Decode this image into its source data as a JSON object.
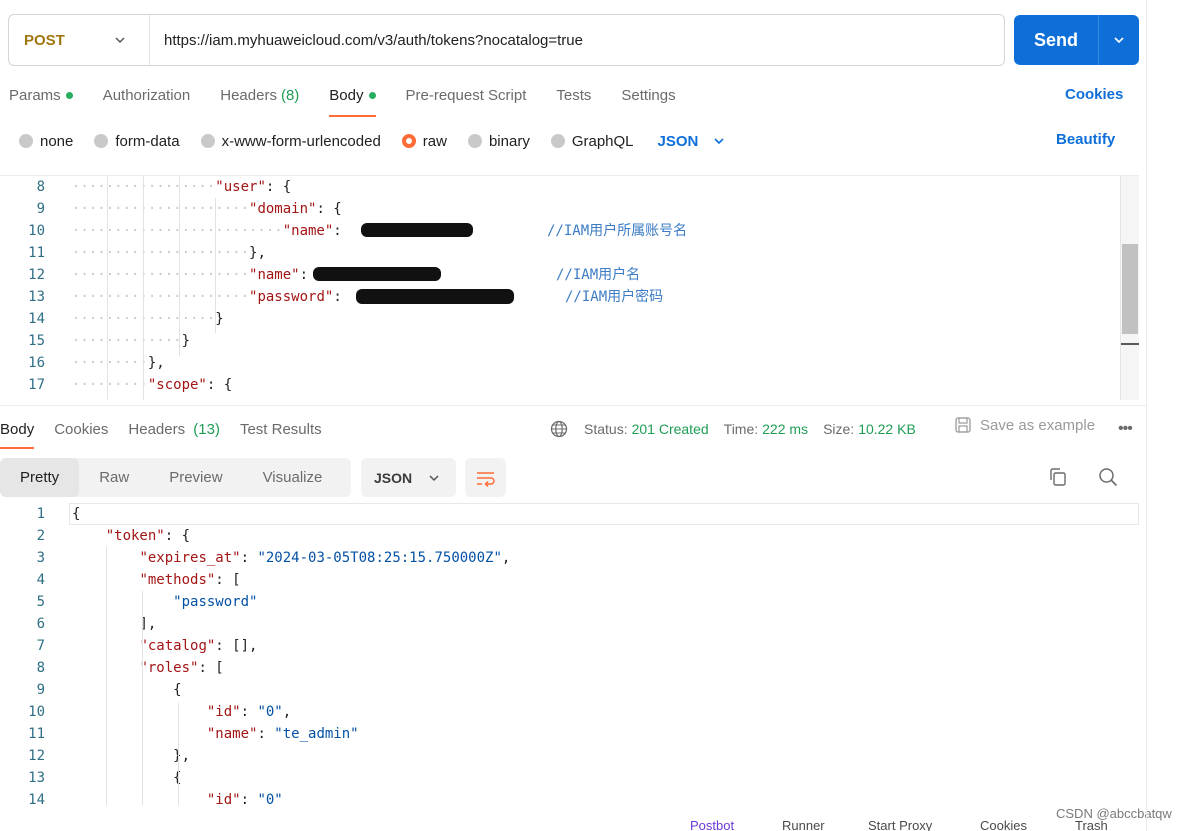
{
  "request": {
    "method": "POST",
    "url": "https://iam.myhuaweicloud.com/v3/auth/tokens?nocatalog=true",
    "send_label": "Send"
  },
  "request_tabs": [
    {
      "label": "Params",
      "dot": true
    },
    {
      "label": "Authorization"
    },
    {
      "label": "Headers",
      "count": "(8)"
    },
    {
      "label": "Body",
      "dot": true,
      "active": true
    },
    {
      "label": "Pre-request Script"
    },
    {
      "label": "Tests"
    },
    {
      "label": "Settings"
    }
  ],
  "cookies_link": "Cookies",
  "body_types": [
    "none",
    "form-data",
    "x-www-form-urlencoded",
    "raw",
    "binary",
    "GraphQL"
  ],
  "body_type_selected": "raw",
  "body_lang": "JSON",
  "beautify_label": "Beautify",
  "request_code": [
    {
      "n": "8",
      "parts": [
        [
          "k",
          "\"user\""
        ],
        [
          "p",
          ": {"
        ]
      ]
    },
    {
      "n": "9",
      "parts": [
        [
          "k",
          "\"domain\""
        ],
        [
          "p",
          ": {"
        ]
      ]
    },
    {
      "n": "10",
      "parts": [
        [
          "k",
          "\"name\""
        ],
        [
          "p",
          ": "
        ]
      ],
      "comment": "//IAM用户所属账号名"
    },
    {
      "n": "11",
      "parts": [
        [
          "p",
          "},"
        ]
      ]
    },
    {
      "n": "12",
      "parts": [
        [
          "k",
          "\"name\""
        ],
        [
          "p",
          ":"
        ]
      ],
      "comment": "//IAM用户名"
    },
    {
      "n": "13",
      "parts": [
        [
          "k",
          "\"password\""
        ],
        [
          "p",
          ": "
        ]
      ],
      "comment": "//IAM用户密码"
    },
    {
      "n": "14",
      "parts": [
        [
          "p",
          "}"
        ]
      ]
    },
    {
      "n": "15",
      "parts": [
        [
          "p",
          "}"
        ]
      ]
    },
    {
      "n": "16",
      "parts": [
        [
          "p",
          "},"
        ]
      ]
    },
    {
      "n": "17",
      "parts": [
        [
          "k",
          "\"scope\""
        ],
        [
          "p",
          ": {"
        ]
      ]
    }
  ],
  "response_tabs": [
    {
      "label": "Body",
      "active": true
    },
    {
      "label": "Cookies"
    },
    {
      "label": "Headers",
      "count": "(13)"
    },
    {
      "label": "Test Results"
    }
  ],
  "status": {
    "status_label": "Status:",
    "status_value": "201 Created",
    "time_label": "Time:",
    "time_value": "222 ms",
    "size_label": "Size:",
    "size_value": "10.22 KB"
  },
  "save_example_label": "Save as example",
  "view_modes": [
    "Pretty",
    "Raw",
    "Preview",
    "Visualize"
  ],
  "response_format": "JSON",
  "response_code": [
    {
      "n": "1",
      "parts": [
        [
          "p",
          "{"
        ]
      ]
    },
    {
      "n": "2",
      "parts": [
        [
          "k",
          "\"token\""
        ],
        [
          "p",
          ": {"
        ]
      ]
    },
    {
      "n": "3",
      "parts": [
        [
          "k",
          "\"expires_at\""
        ],
        [
          "p",
          ": "
        ],
        [
          "s",
          "\"2024-03-05T08:25:15.750000Z\""
        ],
        [
          "p",
          ","
        ]
      ]
    },
    {
      "n": "4",
      "parts": [
        [
          "k",
          "\"methods\""
        ],
        [
          "p",
          ": ["
        ]
      ]
    },
    {
      "n": "5",
      "parts": [
        [
          "s",
          "\"password\""
        ]
      ]
    },
    {
      "n": "6",
      "parts": [
        [
          "p",
          "],"
        ]
      ]
    },
    {
      "n": "7",
      "parts": [
        [
          "k",
          "\"catalog\""
        ],
        [
          "p",
          ": [],"
        ]
      ]
    },
    {
      "n": "8",
      "parts": [
        [
          "k",
          "\"roles\""
        ],
        [
          "p",
          ": ["
        ]
      ]
    },
    {
      "n": "9",
      "parts": [
        [
          "p",
          "{"
        ]
      ]
    },
    {
      "n": "10",
      "parts": [
        [
          "k",
          "\"id\""
        ],
        [
          "p",
          ": "
        ],
        [
          "s",
          "\"0\""
        ],
        [
          "p",
          ","
        ]
      ]
    },
    {
      "n": "11",
      "parts": [
        [
          "k",
          "\"name\""
        ],
        [
          "p",
          ": "
        ],
        [
          "s",
          "\"te_admin\""
        ]
      ]
    },
    {
      "n": "12",
      "parts": [
        [
          "p",
          "},"
        ]
      ]
    },
    {
      "n": "13",
      "parts": [
        [
          "p",
          "{"
        ]
      ]
    },
    {
      "n": "14",
      "parts": [
        [
          "k",
          "\"id\""
        ],
        [
          "p",
          ": "
        ],
        [
          "s",
          "\"0\""
        ]
      ]
    }
  ],
  "footer": [
    "Postbot",
    "Runner",
    "Start Proxy",
    "Cookies",
    "Trash"
  ],
  "watermark": "CSDN @abccbatqw",
  "colors": {
    "accent": "#ff6c37",
    "primary": "#0f6fd9",
    "success": "#1f9d55",
    "method": "#a0770f"
  }
}
